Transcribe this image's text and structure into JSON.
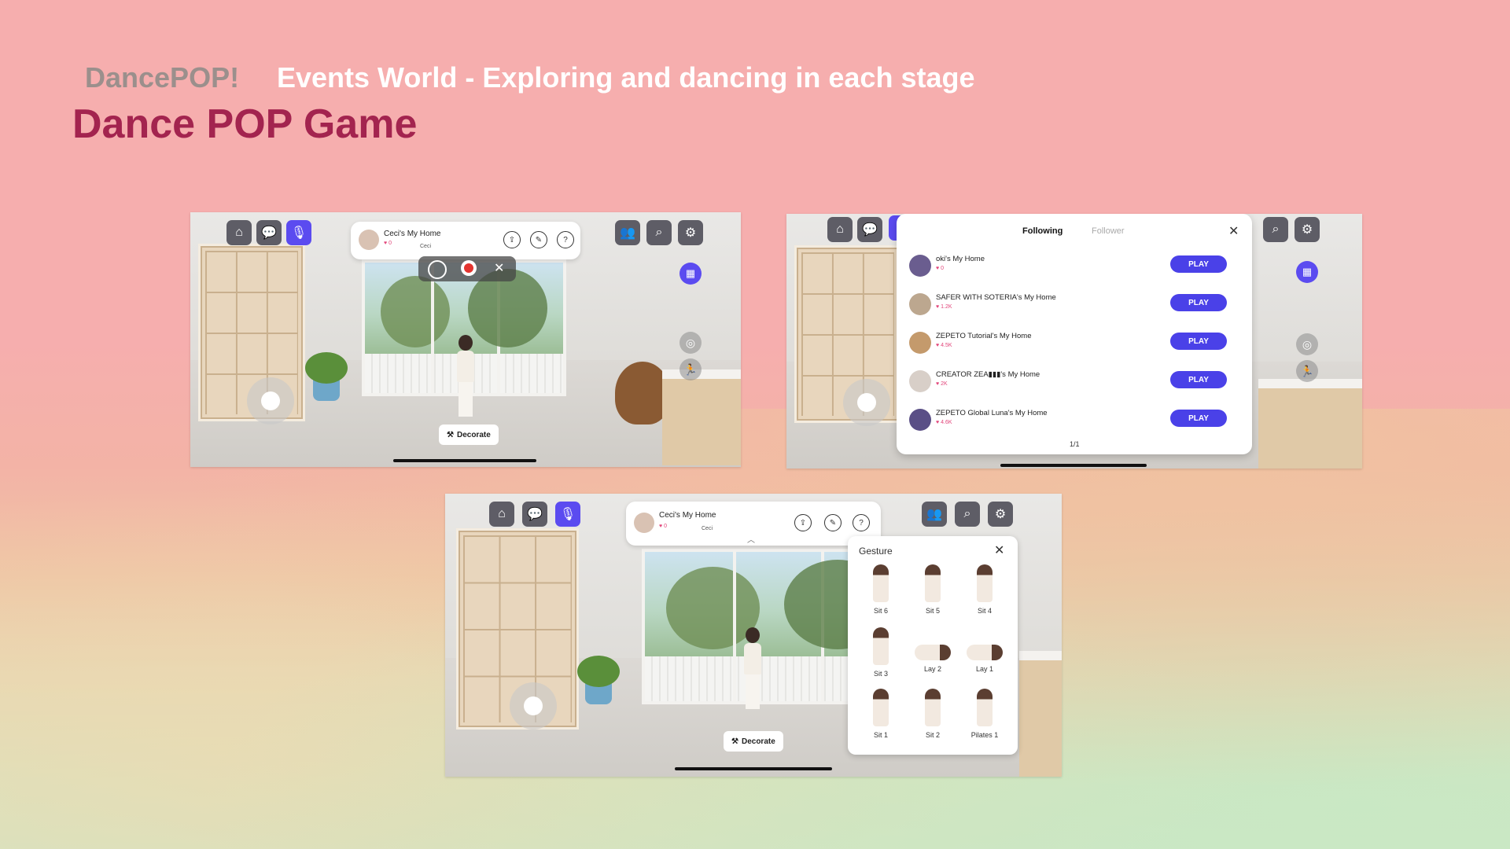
{
  "header": {
    "brand": "DancePOP!",
    "subtitle": "Events World - Exploring and dancing in each stage",
    "title": "Dance POP Game"
  },
  "colors": {
    "accent": "#5b4bf0",
    "play_button": "#4a41e8",
    "title": "#a3244f",
    "like": "#e2457a"
  },
  "icons": {
    "home": "home-icon",
    "chat": "chat-bubble-icon",
    "mic": "microphone-icon",
    "friends": "friends-icon",
    "world": "world-search-icon",
    "settings": "gear-icon",
    "calendar": "calendar-icon",
    "camera": "camera-icon",
    "gesture": "gesture-icon"
  },
  "screen1": {
    "home_card": {
      "name": "Ceci's My Home",
      "likes": "0",
      "owner": "Ceci"
    },
    "decorate_label": "Decorate"
  },
  "screen2": {
    "tabs": [
      "Following",
      "Follower"
    ],
    "rows": [
      {
        "name": "oki's My Home",
        "likes": "0",
        "button": "PLAY"
      },
      {
        "name": "SAFER WITH SOTERIA's My Home",
        "likes": "1.2K",
        "button": "PLAY"
      },
      {
        "name": "ZEPETO Tutorial's My Home",
        "likes": "4.5K",
        "button": "PLAY"
      },
      {
        "name": "CREATOR ZEA▮▮▮'s My Home",
        "likes": "2K",
        "button": "PLAY"
      },
      {
        "name": "ZEPETO Global Luna's My Home",
        "likes": "4.6K",
        "button": "PLAY"
      }
    ],
    "pager": "1/1"
  },
  "screen3": {
    "home_card": {
      "name": "Ceci's My Home",
      "likes": "0",
      "owner": "Ceci"
    },
    "decorate_label": "Decorate",
    "gesture_panel": {
      "title": "Gesture",
      "items": [
        "Sit 6",
        "Sit 5",
        "Sit 4",
        "Sit 3",
        "Lay 2",
        "Lay 1",
        "Sit 1",
        "Sit 2",
        "Pilates 1"
      ]
    }
  }
}
